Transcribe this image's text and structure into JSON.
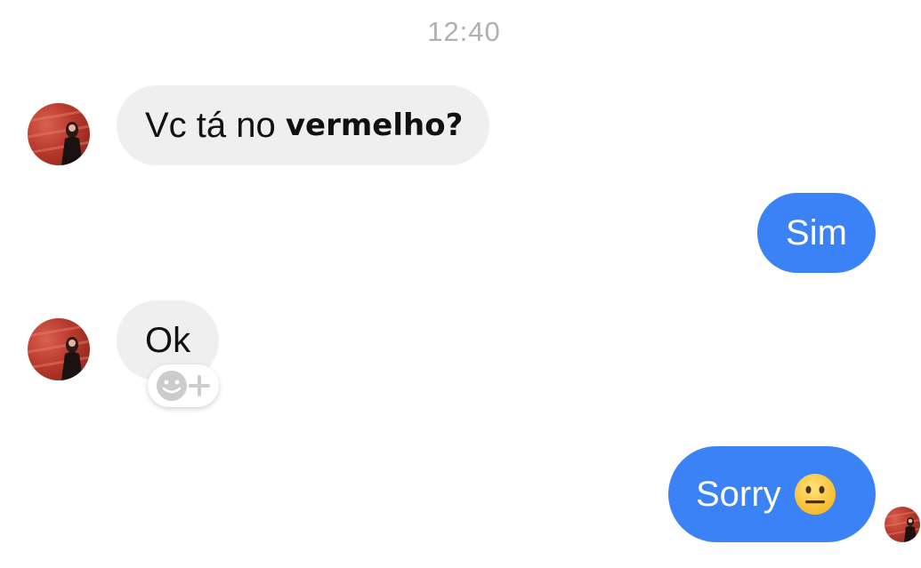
{
  "timestamp": "12:40",
  "messages": [
    {
      "direction": "incoming",
      "text_regular": "Vc tá no ",
      "text_bold": "vermelho?"
    },
    {
      "direction": "outgoing",
      "text": "Sim"
    },
    {
      "direction": "incoming",
      "text": "Ok",
      "reaction_control": "add-reaction-icon"
    },
    {
      "direction": "outgoing",
      "text": "Sorry",
      "emoji": "neutral-face-emoji"
    }
  ],
  "colors": {
    "incoming_bubble": "#efefef",
    "outgoing_bubble": "#3a82f6",
    "timestamp": "#b0b0b0"
  }
}
